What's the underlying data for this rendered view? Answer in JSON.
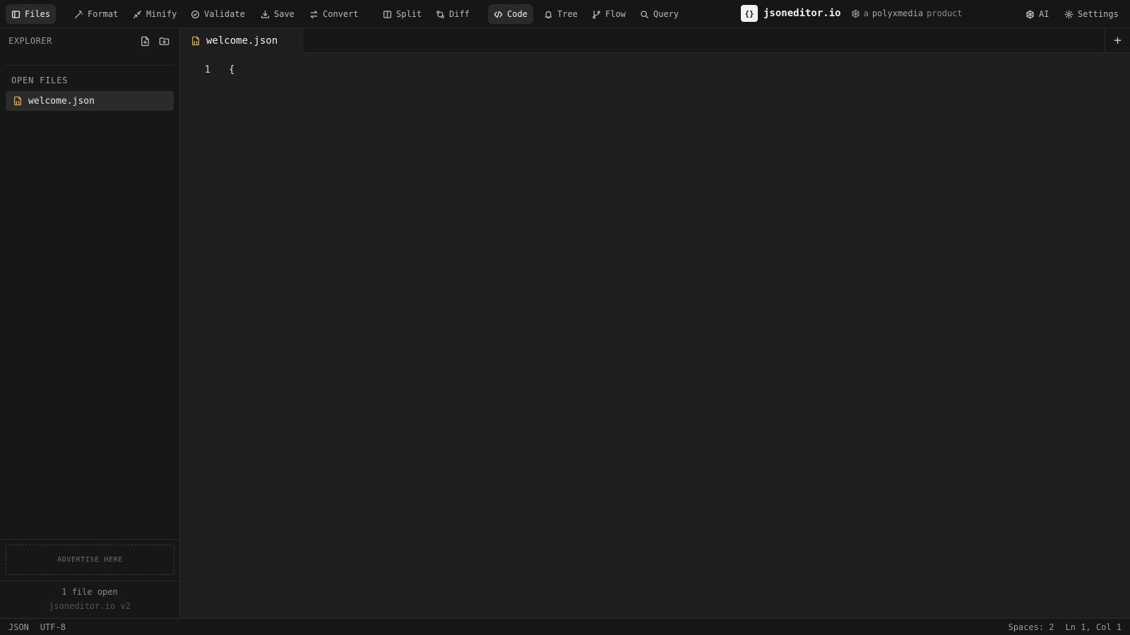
{
  "toolbar": {
    "files": "Files",
    "format": "Format",
    "minify": "Minify",
    "validate": "Validate",
    "save": "Save",
    "convert": "Convert",
    "split": "Split",
    "diff": "Diff",
    "code": "Code",
    "tree": "Tree",
    "flow": "Flow",
    "query": "Query",
    "ai": "AI",
    "settings": "Settings"
  },
  "brand": {
    "logo": "{}",
    "name": "jsoneditor.io",
    "sub_prefix": "a",
    "sub_company": "polyxmedia",
    "sub_suffix": "product"
  },
  "sidebar": {
    "explorer_title": "EXPLORER",
    "open_files_label": "OPEN FILES",
    "files": [
      {
        "name": "welcome.json"
      }
    ],
    "ad_text": "ADVERTISE HERE",
    "file_count": "1 file open",
    "version": "jsoneditor.io v2"
  },
  "tabs": [
    {
      "name": "welcome.json"
    }
  ],
  "tab_add": "+",
  "editor": {
    "lines": [
      {
        "number": "1",
        "text": "{"
      }
    ]
  },
  "status": {
    "language": "JSON",
    "encoding": "UTF-8",
    "spaces": "Spaces: 2",
    "position": "Ln 1, Col 1"
  },
  "colors": {
    "json_file_icon": "#e8b339",
    "background": "#1e1e1e",
    "panel": "#171717"
  }
}
